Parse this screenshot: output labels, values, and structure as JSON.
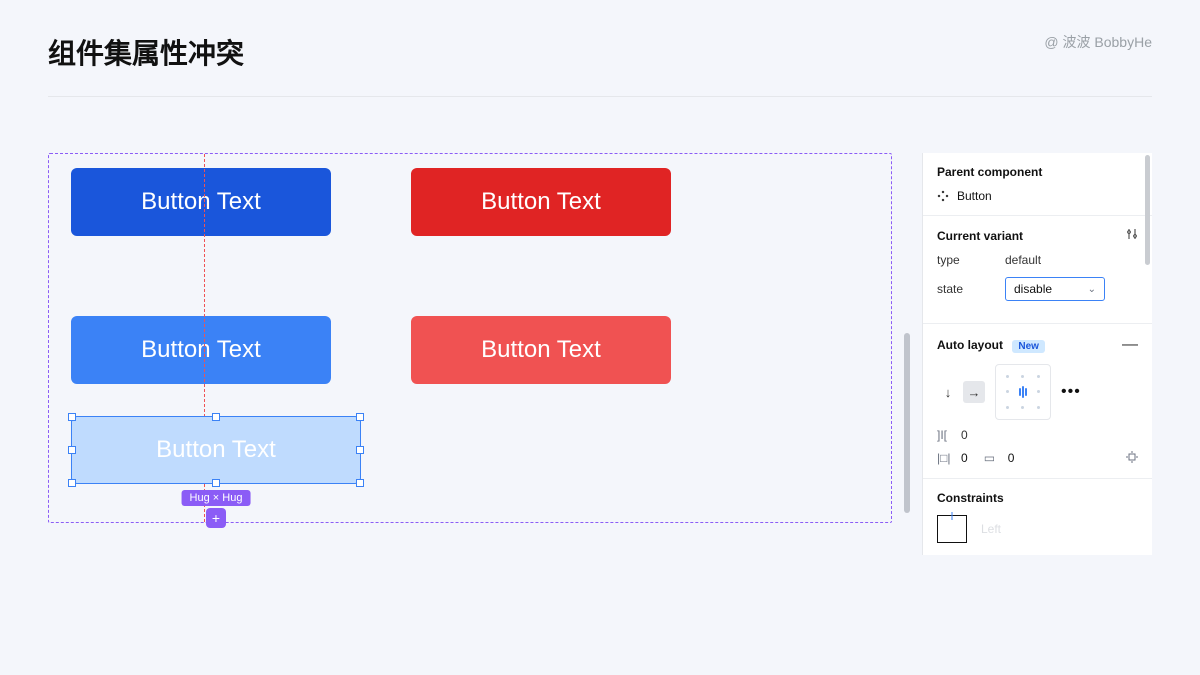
{
  "header": {
    "title": "组件集属性冲突",
    "author": "@ 波波 BobbyHe"
  },
  "canvas": {
    "button_label": "Button Text",
    "size_badge": "Hug × Hug"
  },
  "inspector": {
    "parent_component": {
      "section_title": "Parent component",
      "name": "Button"
    },
    "current_variant": {
      "section_title": "Current variant",
      "type_label": "type",
      "type_value": "default",
      "state_label": "state",
      "state_value": "disable"
    },
    "auto_layout": {
      "section_title": "Auto layout",
      "badge": "New",
      "gap_value": "0",
      "pad_h_value": "0",
      "pad_v_value": "0"
    },
    "constraints": {
      "section_title": "Constraints",
      "value": "Left"
    }
  }
}
